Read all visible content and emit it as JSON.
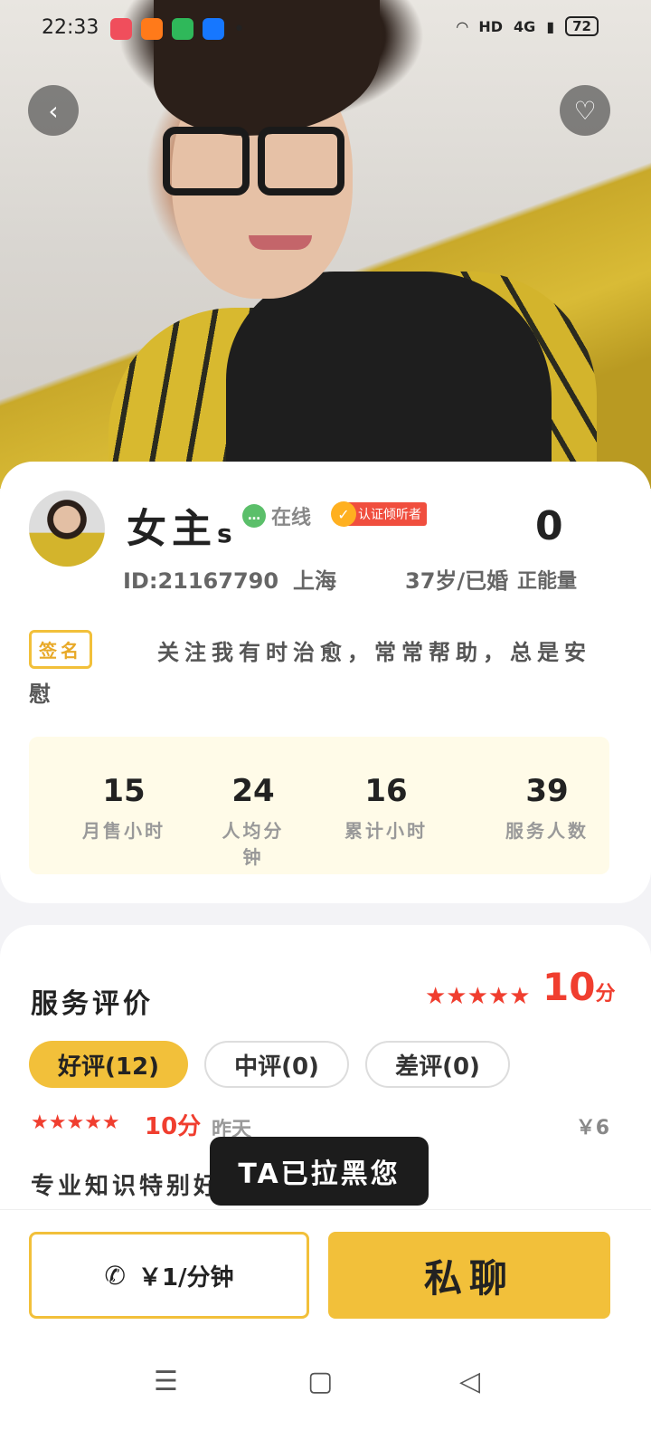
{
  "status_bar": {
    "time": "22:33",
    "app_colors": [
      "#f04e5c",
      "#ff7a1a",
      "#2fb85a",
      "#1677ff"
    ],
    "right_text": "HD",
    "network": "4G",
    "battery": "72"
  },
  "profile": {
    "name": "女主",
    "name_suffix": "s",
    "online_label": "在线",
    "cert_label": "认证倾听者",
    "id_text": "ID:21167790",
    "city": "上海",
    "age_status": "37岁/已婚",
    "energy_value": "0",
    "energy_label": "正能量",
    "sign_tag": "签名",
    "sign_text": "关注我有时治愈，常常帮助，总是安慰"
  },
  "stats": [
    {
      "value": "15",
      "label": "月售小时"
    },
    {
      "value": "24",
      "label": "人均分钟"
    },
    {
      "value": "16",
      "label": "累计小时"
    },
    {
      "value": "39",
      "label": "服务人数"
    }
  ],
  "reviews": {
    "title": "服务评价",
    "stars": "★★★★★",
    "score": "10",
    "score_unit": "分",
    "tabs": {
      "good": "好评(12)",
      "mid": "中评(0)",
      "bad": "差评(0)"
    },
    "item": {
      "stars": "★★★★★",
      "score": "10分",
      "time": "昨天",
      "price": "￥6",
      "text": "专业知识特别好"
    }
  },
  "toast": "TA已拉黑您",
  "actions": {
    "call_label": "￥1/分钟",
    "chat_label": "私聊"
  },
  "colors": {
    "accent": "#f2c03a",
    "red": "#f03e2f"
  }
}
